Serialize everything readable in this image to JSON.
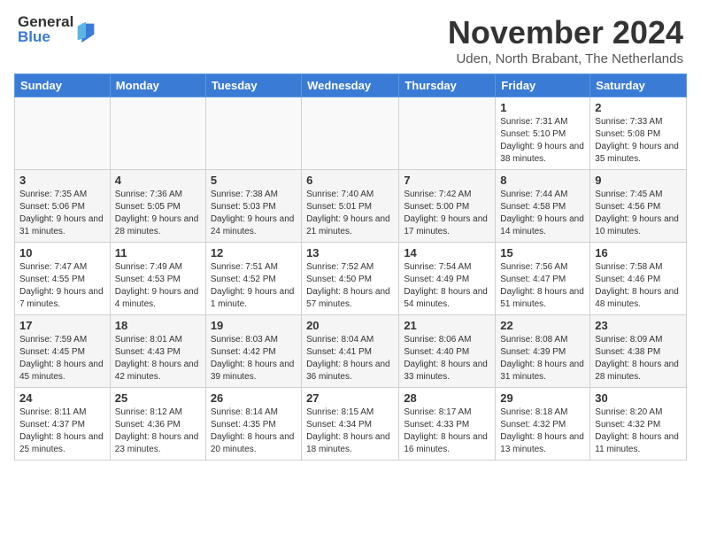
{
  "header": {
    "logo_general": "General",
    "logo_blue": "Blue",
    "month_title": "November 2024",
    "location": "Uden, North Brabant, The Netherlands"
  },
  "days_of_week": [
    "Sunday",
    "Monday",
    "Tuesday",
    "Wednesday",
    "Thursday",
    "Friday",
    "Saturday"
  ],
  "weeks": [
    [
      {
        "day": "",
        "info": ""
      },
      {
        "day": "",
        "info": ""
      },
      {
        "day": "",
        "info": ""
      },
      {
        "day": "",
        "info": ""
      },
      {
        "day": "",
        "info": ""
      },
      {
        "day": "1",
        "info": "Sunrise: 7:31 AM\nSunset: 5:10 PM\nDaylight: 9 hours and 38 minutes."
      },
      {
        "day": "2",
        "info": "Sunrise: 7:33 AM\nSunset: 5:08 PM\nDaylight: 9 hours and 35 minutes."
      }
    ],
    [
      {
        "day": "3",
        "info": "Sunrise: 7:35 AM\nSunset: 5:06 PM\nDaylight: 9 hours and 31 minutes."
      },
      {
        "day": "4",
        "info": "Sunrise: 7:36 AM\nSunset: 5:05 PM\nDaylight: 9 hours and 28 minutes."
      },
      {
        "day": "5",
        "info": "Sunrise: 7:38 AM\nSunset: 5:03 PM\nDaylight: 9 hours and 24 minutes."
      },
      {
        "day": "6",
        "info": "Sunrise: 7:40 AM\nSunset: 5:01 PM\nDaylight: 9 hours and 21 minutes."
      },
      {
        "day": "7",
        "info": "Sunrise: 7:42 AM\nSunset: 5:00 PM\nDaylight: 9 hours and 17 minutes."
      },
      {
        "day": "8",
        "info": "Sunrise: 7:44 AM\nSunset: 4:58 PM\nDaylight: 9 hours and 14 minutes."
      },
      {
        "day": "9",
        "info": "Sunrise: 7:45 AM\nSunset: 4:56 PM\nDaylight: 9 hours and 10 minutes."
      }
    ],
    [
      {
        "day": "10",
        "info": "Sunrise: 7:47 AM\nSunset: 4:55 PM\nDaylight: 9 hours and 7 minutes."
      },
      {
        "day": "11",
        "info": "Sunrise: 7:49 AM\nSunset: 4:53 PM\nDaylight: 9 hours and 4 minutes."
      },
      {
        "day": "12",
        "info": "Sunrise: 7:51 AM\nSunset: 4:52 PM\nDaylight: 9 hours and 1 minute."
      },
      {
        "day": "13",
        "info": "Sunrise: 7:52 AM\nSunset: 4:50 PM\nDaylight: 8 hours and 57 minutes."
      },
      {
        "day": "14",
        "info": "Sunrise: 7:54 AM\nSunset: 4:49 PM\nDaylight: 8 hours and 54 minutes."
      },
      {
        "day": "15",
        "info": "Sunrise: 7:56 AM\nSunset: 4:47 PM\nDaylight: 8 hours and 51 minutes."
      },
      {
        "day": "16",
        "info": "Sunrise: 7:58 AM\nSunset: 4:46 PM\nDaylight: 8 hours and 48 minutes."
      }
    ],
    [
      {
        "day": "17",
        "info": "Sunrise: 7:59 AM\nSunset: 4:45 PM\nDaylight: 8 hours and 45 minutes."
      },
      {
        "day": "18",
        "info": "Sunrise: 8:01 AM\nSunset: 4:43 PM\nDaylight: 8 hours and 42 minutes."
      },
      {
        "day": "19",
        "info": "Sunrise: 8:03 AM\nSunset: 4:42 PM\nDaylight: 8 hours and 39 minutes."
      },
      {
        "day": "20",
        "info": "Sunrise: 8:04 AM\nSunset: 4:41 PM\nDaylight: 8 hours and 36 minutes."
      },
      {
        "day": "21",
        "info": "Sunrise: 8:06 AM\nSunset: 4:40 PM\nDaylight: 8 hours and 33 minutes."
      },
      {
        "day": "22",
        "info": "Sunrise: 8:08 AM\nSunset: 4:39 PM\nDaylight: 8 hours and 31 minutes."
      },
      {
        "day": "23",
        "info": "Sunrise: 8:09 AM\nSunset: 4:38 PM\nDaylight: 8 hours and 28 minutes."
      }
    ],
    [
      {
        "day": "24",
        "info": "Sunrise: 8:11 AM\nSunset: 4:37 PM\nDaylight: 8 hours and 25 minutes."
      },
      {
        "day": "25",
        "info": "Sunrise: 8:12 AM\nSunset: 4:36 PM\nDaylight: 8 hours and 23 minutes."
      },
      {
        "day": "26",
        "info": "Sunrise: 8:14 AM\nSunset: 4:35 PM\nDaylight: 8 hours and 20 minutes."
      },
      {
        "day": "27",
        "info": "Sunrise: 8:15 AM\nSunset: 4:34 PM\nDaylight: 8 hours and 18 minutes."
      },
      {
        "day": "28",
        "info": "Sunrise: 8:17 AM\nSunset: 4:33 PM\nDaylight: 8 hours and 16 minutes."
      },
      {
        "day": "29",
        "info": "Sunrise: 8:18 AM\nSunset: 4:32 PM\nDaylight: 8 hours and 13 minutes."
      },
      {
        "day": "30",
        "info": "Sunrise: 8:20 AM\nSunset: 4:32 PM\nDaylight: 8 hours and 11 minutes."
      }
    ]
  ]
}
